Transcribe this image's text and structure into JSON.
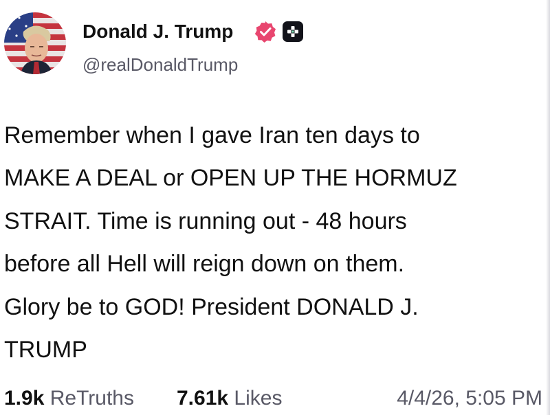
{
  "author": {
    "display_name": "Donald J. Trump",
    "handle": "@realDonaldTrump",
    "avatar_icon": "profile-photo-flag-background",
    "verified_badge_icon": "verified-check-icon",
    "verified_color": "#e8466f",
    "plus_badge_icon": "plus-badge-icon"
  },
  "post": {
    "lines": [
      "Remember when I gave Iran ten days to",
      "MAKE A DEAL or OPEN UP THE HORMUZ",
      "STRAIT. Time is running out - 48 hours",
      "before all Hell will reign down on them.",
      "Glory be to GOD! President DONALD J.",
      "TRUMP"
    ]
  },
  "stats": {
    "retruths_count": "1.9k",
    "retruths_label": "ReTruths",
    "likes_count": "7.61k",
    "likes_label": "Likes",
    "timestamp": "4/4/26, 5:05 PM"
  },
  "colors": {
    "text": "#111111",
    "muted": "#595966",
    "badge_dark": "#12131a"
  }
}
